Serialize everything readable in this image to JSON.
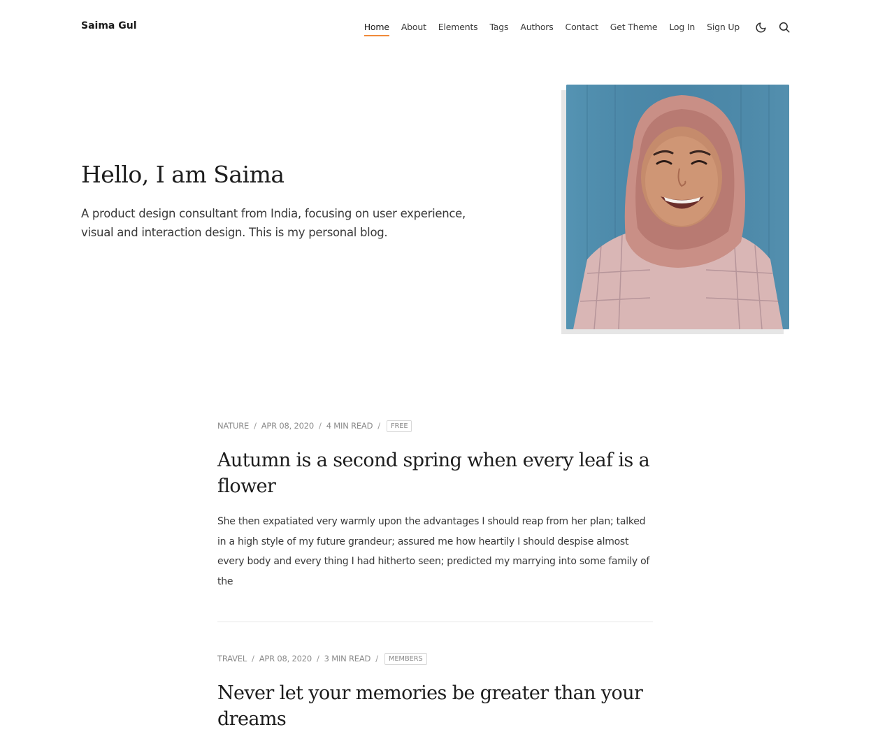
{
  "header": {
    "brand": "Saima Gul",
    "nav": [
      {
        "label": "Home",
        "active": true
      },
      {
        "label": "About"
      },
      {
        "label": "Elements"
      },
      {
        "label": "Tags"
      },
      {
        "label": "Authors"
      },
      {
        "label": "Contact"
      },
      {
        "label": "Get Theme"
      },
      {
        "label": "Log In"
      },
      {
        "label": "Sign Up"
      }
    ],
    "icons": [
      "moon-icon",
      "search-icon"
    ],
    "accent_color": "#f08a3a"
  },
  "hero": {
    "title": "Hello, I am Saima",
    "description": "A product design consultant from India, focusing on user experience, visual and interaction design. This is my personal blog."
  },
  "posts": [
    {
      "tag": "NATURE",
      "date": "APR 08, 2020",
      "read_time": "4 MIN READ",
      "access": "FREE",
      "title": "Autumn is a second spring when every leaf is a flower",
      "excerpt": "She then expatiated very warmly upon the advantages I should reap from her plan; talked in a high style of my future grandeur; assured me how heartily I should despise almost every body and every thing I had hitherto seen; predicted my marrying into some family of the"
    },
    {
      "tag": "TRAVEL",
      "date": "APR 08, 2020",
      "read_time": "3 MIN READ",
      "access": "MEMBERS",
      "title": "Never let your memories be greater than your dreams"
    }
  ]
}
